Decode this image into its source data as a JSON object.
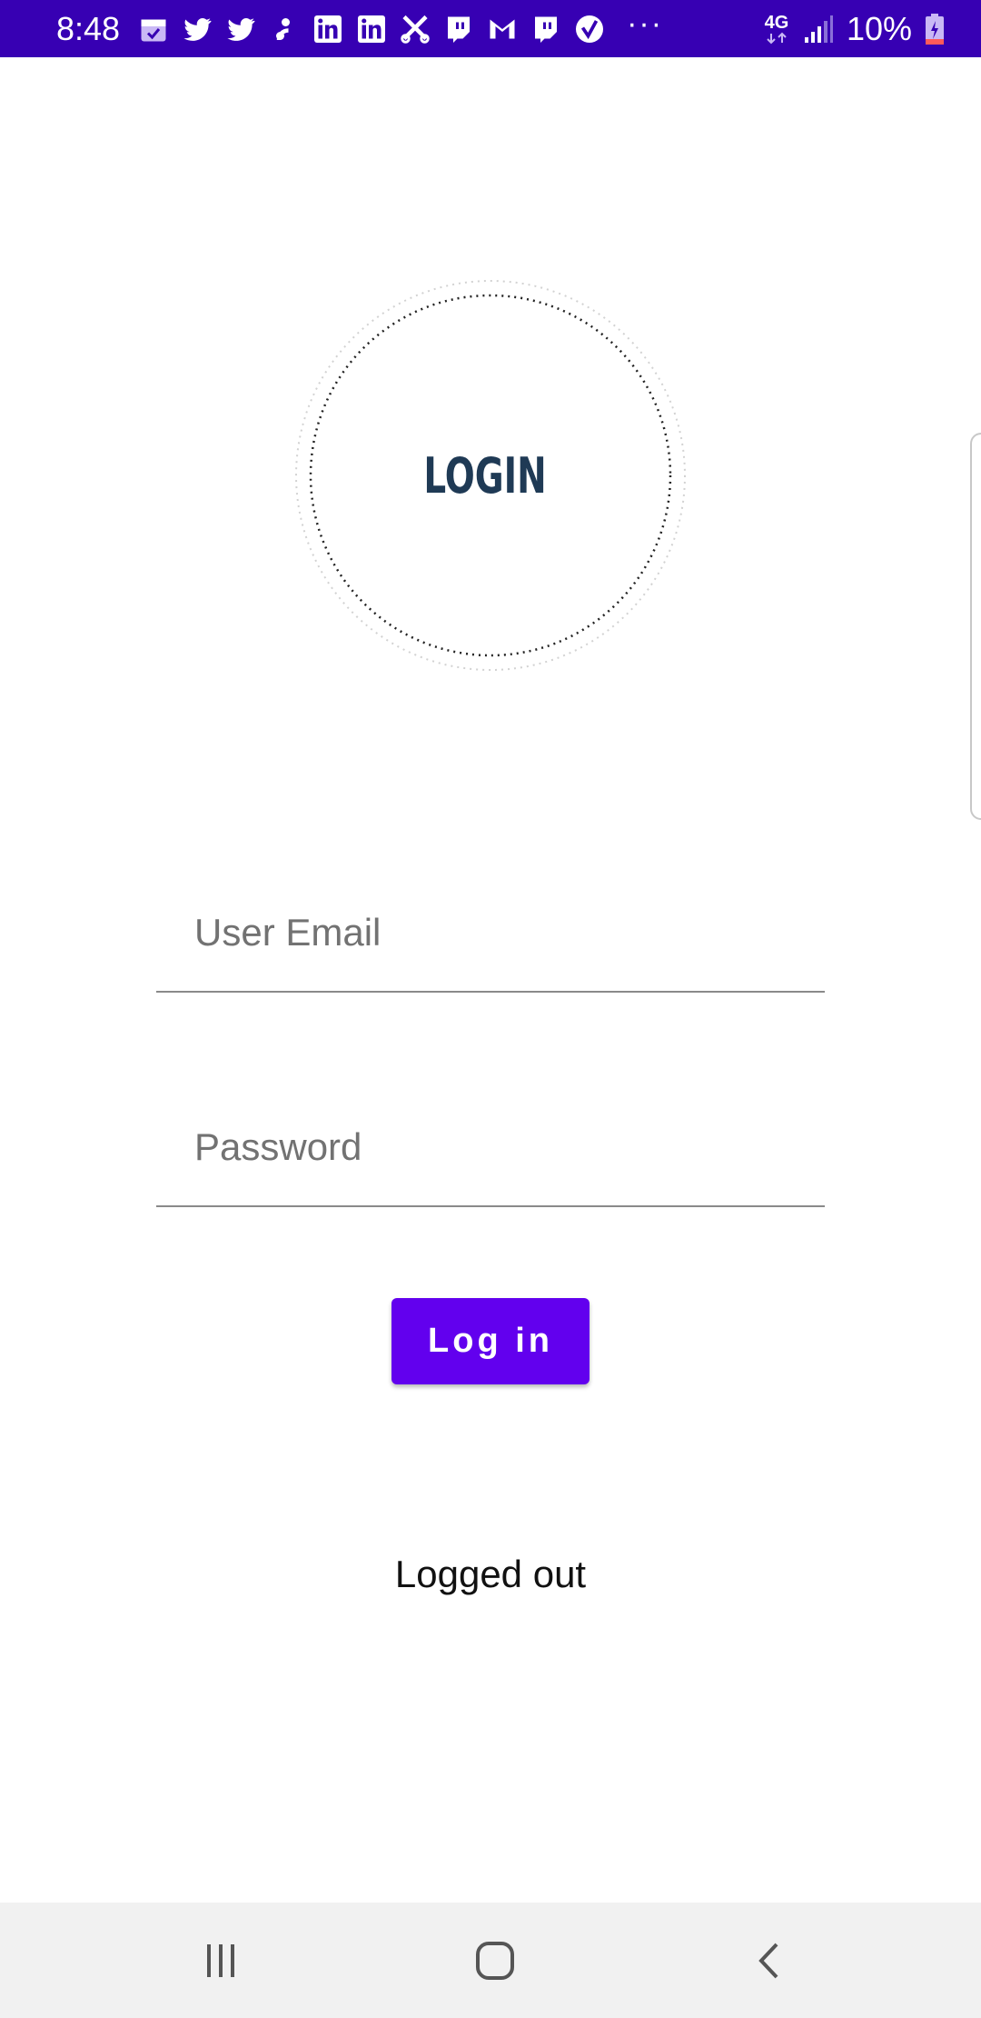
{
  "status_bar": {
    "time": "8:48",
    "notification_icons": [
      "calendar-icon",
      "twitter-icon",
      "twitter-icon",
      "pinwheel-icon",
      "linkedin-icon",
      "linkedin-icon",
      "scissors-icon",
      "twitch-icon",
      "gmail-icon",
      "twitch-icon",
      "verified-check-icon"
    ],
    "more_indicator": "···",
    "network_label": "4G",
    "battery_percent": "10%",
    "background_color": "#3700b3"
  },
  "logo": {
    "text": "LOGIN",
    "text_color": "#1f3a55"
  },
  "form": {
    "email_placeholder": "User Email",
    "email_value": "",
    "password_placeholder": "Password",
    "password_value": "",
    "login_button_label": "Log in",
    "button_color": "#6200ee"
  },
  "auth_status": "Logged out",
  "nav_bar": {
    "icons": [
      "recents-icon",
      "home-icon",
      "back-icon"
    ]
  }
}
